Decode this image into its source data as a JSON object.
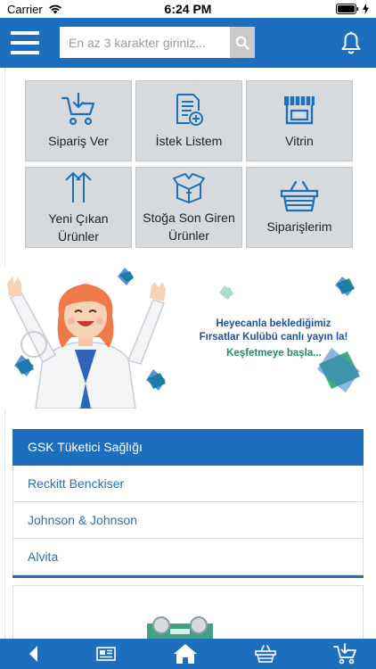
{
  "status": {
    "carrier": "Carrier",
    "time": "6:24 PM"
  },
  "search": {
    "placeholder": "En az 3 karakter giriniz..."
  },
  "tiles": [
    {
      "label": "Sipariş Ver",
      "icon": "cart-download-icon"
    },
    {
      "label": "İstek Listem",
      "icon": "wishlist-document-icon"
    },
    {
      "label": "Vitrin",
      "icon": "storefront-icon"
    },
    {
      "label": "Yeni Çıkan Ürünler",
      "icon": "arrows-up-icon"
    },
    {
      "label": "Stoğa Son Giren Ürünler",
      "icon": "open-box-icon"
    },
    {
      "label": "Siparişlerim",
      "icon": "basket-icon"
    }
  ],
  "banner": {
    "line1": "Heyecanla beklediğimiz",
    "line2": "Fırsatlar Kulübü canlı yayın la!",
    "cta": "Keşfetmeye başla..."
  },
  "brands": [
    {
      "label": "GSK Tüketici Sağlığı",
      "active": true
    },
    {
      "label": "Reckitt Benckiser",
      "active": false
    },
    {
      "label": "Johnson & Johnson",
      "active": false
    },
    {
      "label": "Alvita",
      "active": false
    }
  ],
  "colors": {
    "primary": "#1d6fbd",
    "tile_bg": "#d7dadd",
    "brand_text": "#2d6fad",
    "accent_green": "#1e8f6d"
  },
  "tabbar": [
    "back-icon",
    "news-icon",
    "home-icon",
    "basket-icon",
    "cart-download-icon"
  ]
}
